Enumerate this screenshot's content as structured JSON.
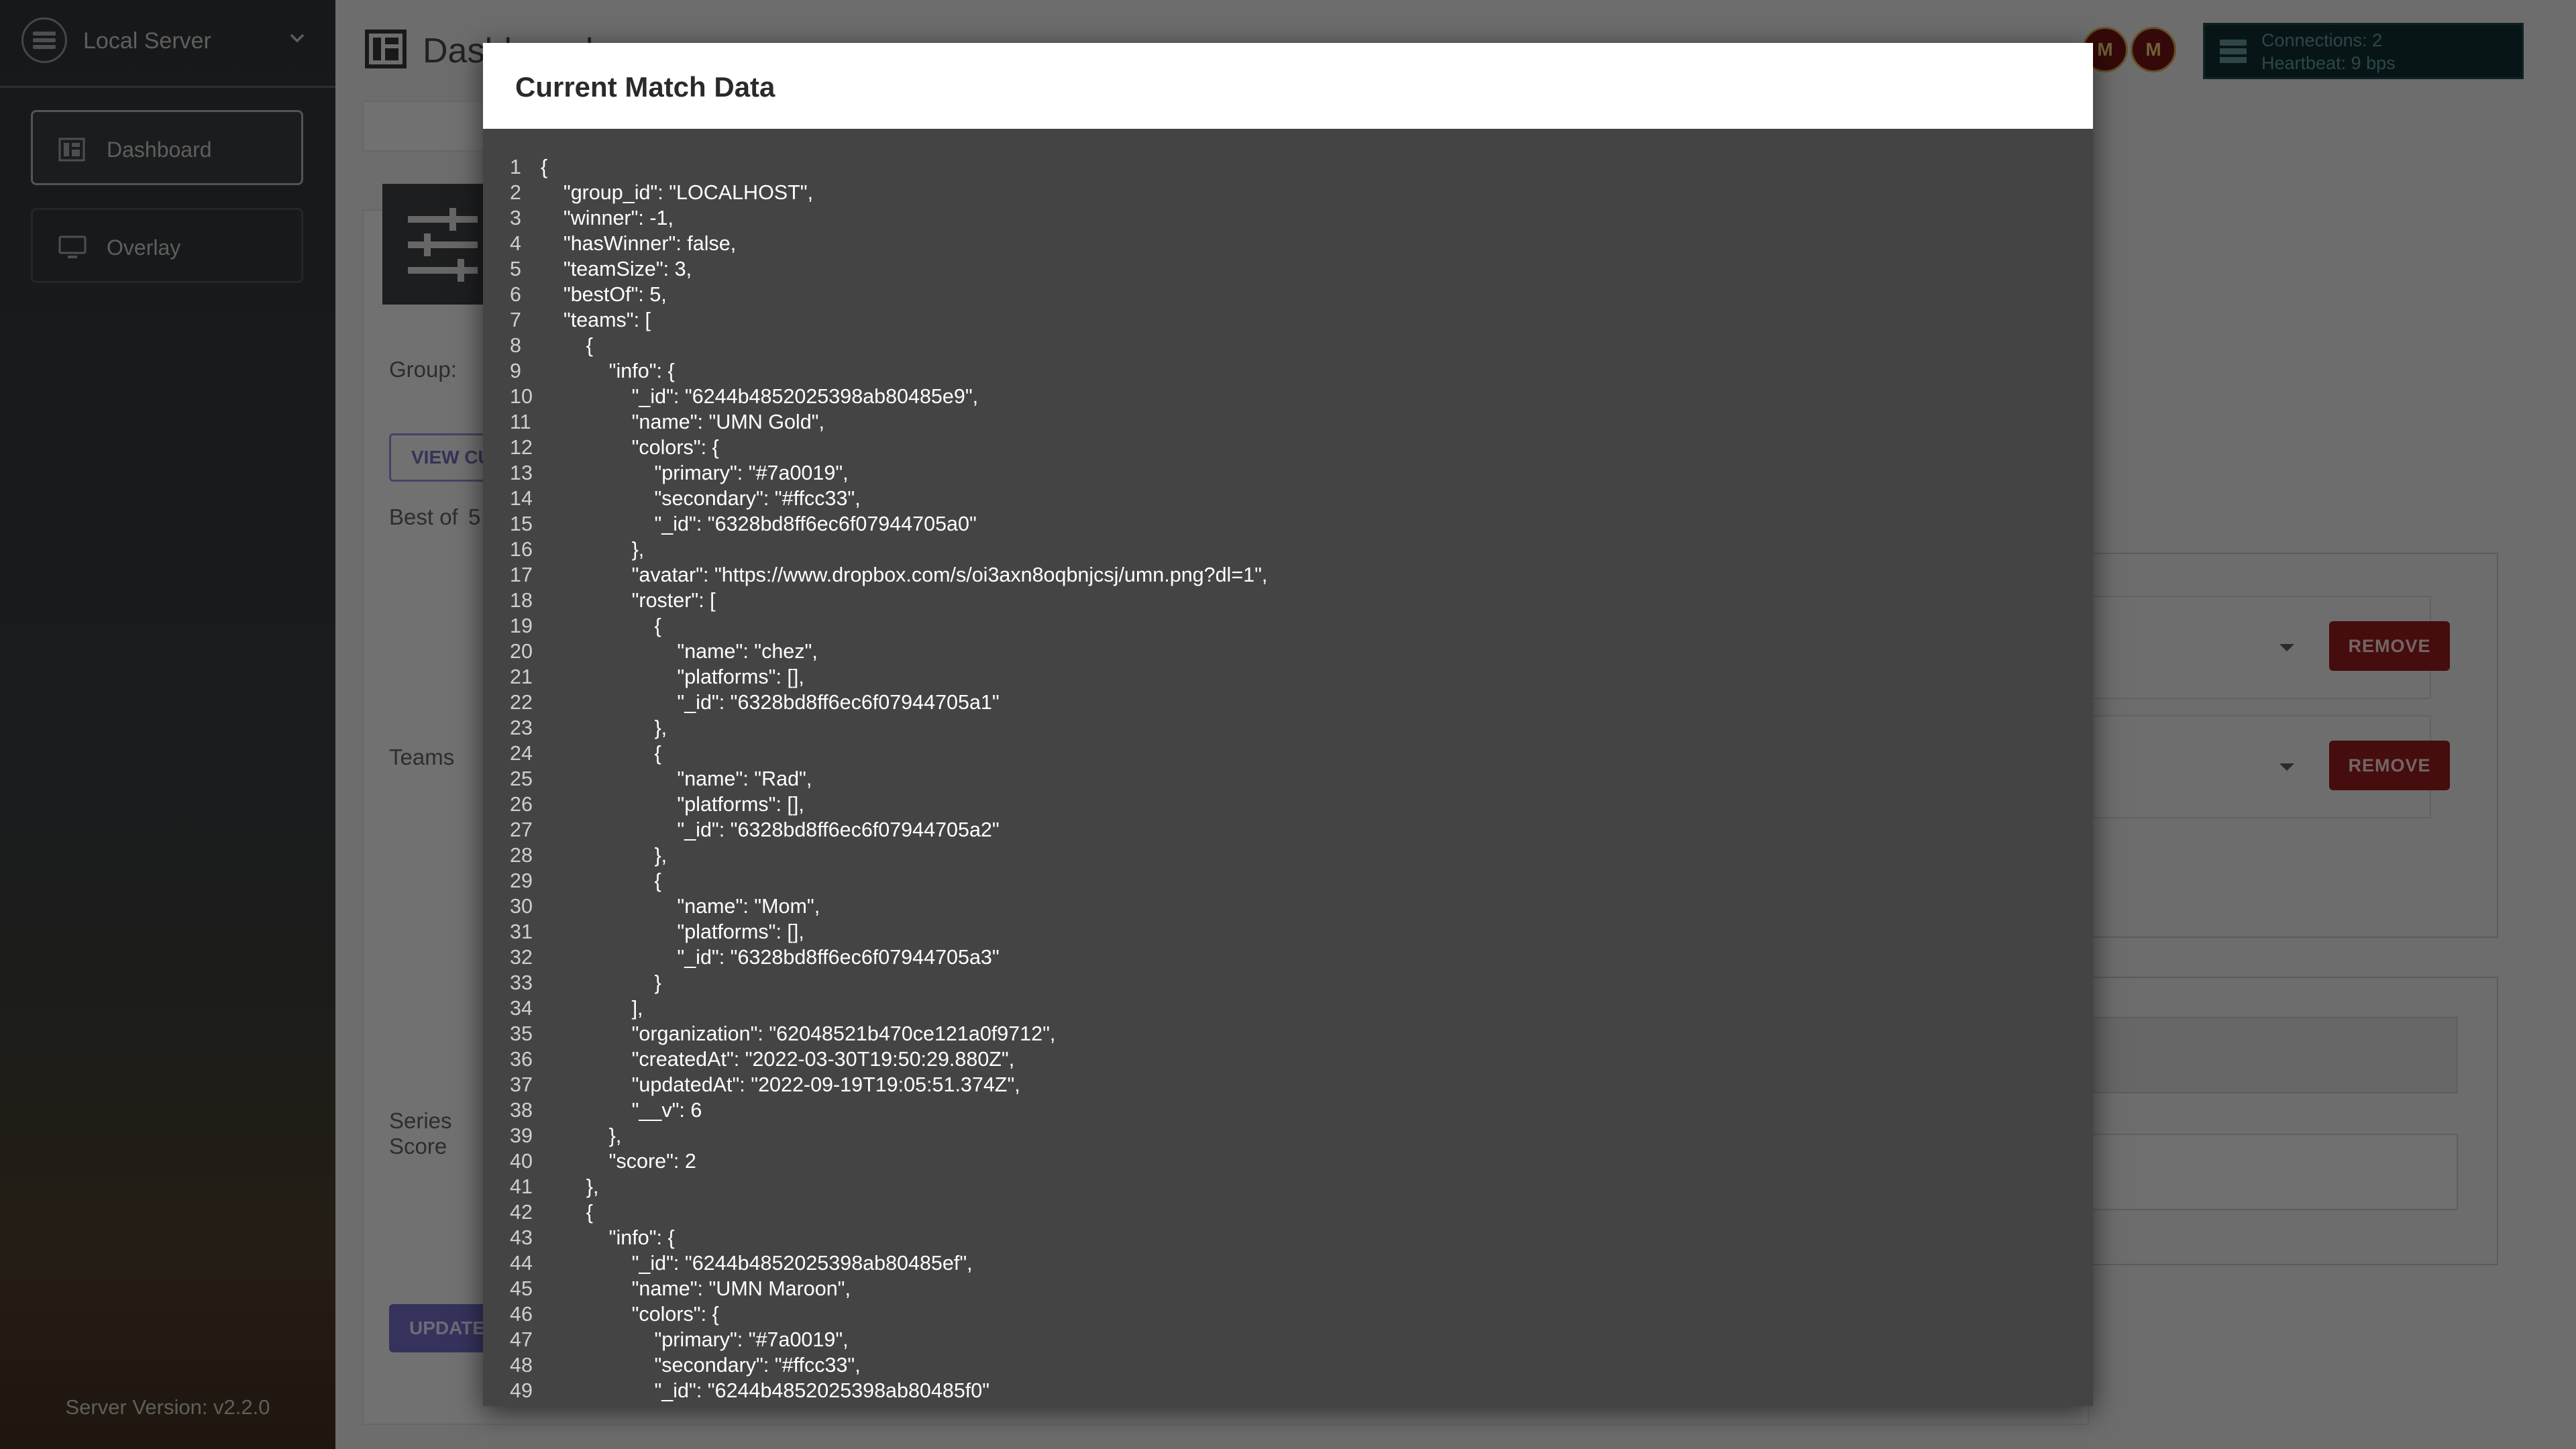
{
  "sidebar": {
    "server_name": "Local Server",
    "server_icon": "server-icon",
    "nav": [
      {
        "label": "Dashboard",
        "icon": "dashboard-icon",
        "active": true
      },
      {
        "label": "Overlay",
        "icon": "monitor-icon",
        "active": false
      }
    ],
    "version": "Server Version: v2.2.0"
  },
  "main": {
    "title": "Dashboard",
    "group_label": "Group:",
    "view_button": "VIEW CURRENT MATCH DATA",
    "best_of_label": "Best of",
    "best_of_value": "5",
    "teams_label": "Teams",
    "series_score_label": "Series Score",
    "update_button": "UPDATE",
    "remove_button": "REMOVE"
  },
  "status": {
    "connections": "Connections: 2",
    "heartbeat": "Heartbeat: 9 bps",
    "colors": {
      "bg": "#0e2a2e",
      "text": "#5f8c92"
    }
  },
  "modal": {
    "title": "Current Match Data",
    "lines": [
      "{",
      "    \"group_id\": \"LOCALHOST\",",
      "    \"winner\": -1,",
      "    \"hasWinner\": false,",
      "    \"teamSize\": 3,",
      "    \"bestOf\": 5,",
      "    \"teams\": [",
      "        {",
      "            \"info\": {",
      "                \"_id\": \"6244b4852025398ab80485e9\",",
      "                \"name\": \"UMN Gold\",",
      "                \"colors\": {",
      "                    \"primary\": \"#7a0019\",",
      "                    \"secondary\": \"#ffcc33\",",
      "                    \"_id\": \"6328bd8ff6ec6f07944705a0\"",
      "                },",
      "                \"avatar\": \"https://www.dropbox.com/s/oi3axn8oqbnjcsj/umn.png?dl=1\",",
      "                \"roster\": [",
      "                    {",
      "                        \"name\": \"chez\",",
      "                        \"platforms\": [],",
      "                        \"_id\": \"6328bd8ff6ec6f07944705a1\"",
      "                    },",
      "                    {",
      "                        \"name\": \"Rad\",",
      "                        \"platforms\": [],",
      "                        \"_id\": \"6328bd8ff6ec6f07944705a2\"",
      "                    },",
      "                    {",
      "                        \"name\": \"Mom\",",
      "                        \"platforms\": [],",
      "                        \"_id\": \"6328bd8ff6ec6f07944705a3\"",
      "                    }",
      "                ],",
      "                \"organization\": \"62048521b470ce121a0f9712\",",
      "                \"createdAt\": \"2022-03-30T19:50:29.880Z\",",
      "                \"updatedAt\": \"2022-09-19T19:05:51.374Z\",",
      "                \"__v\": 6",
      "            },",
      "            \"score\": 2",
      "        },",
      "        {",
      "            \"info\": {",
      "                \"_id\": \"6244b4852025398ab80485ef\",",
      "                \"name\": \"UMN Maroon\",",
      "                \"colors\": {",
      "                    \"primary\": \"#7a0019\",",
      "                    \"secondary\": \"#ffcc33\",",
      "                    \"_id\": \"6244b4852025398ab80485f0\""
    ]
  }
}
